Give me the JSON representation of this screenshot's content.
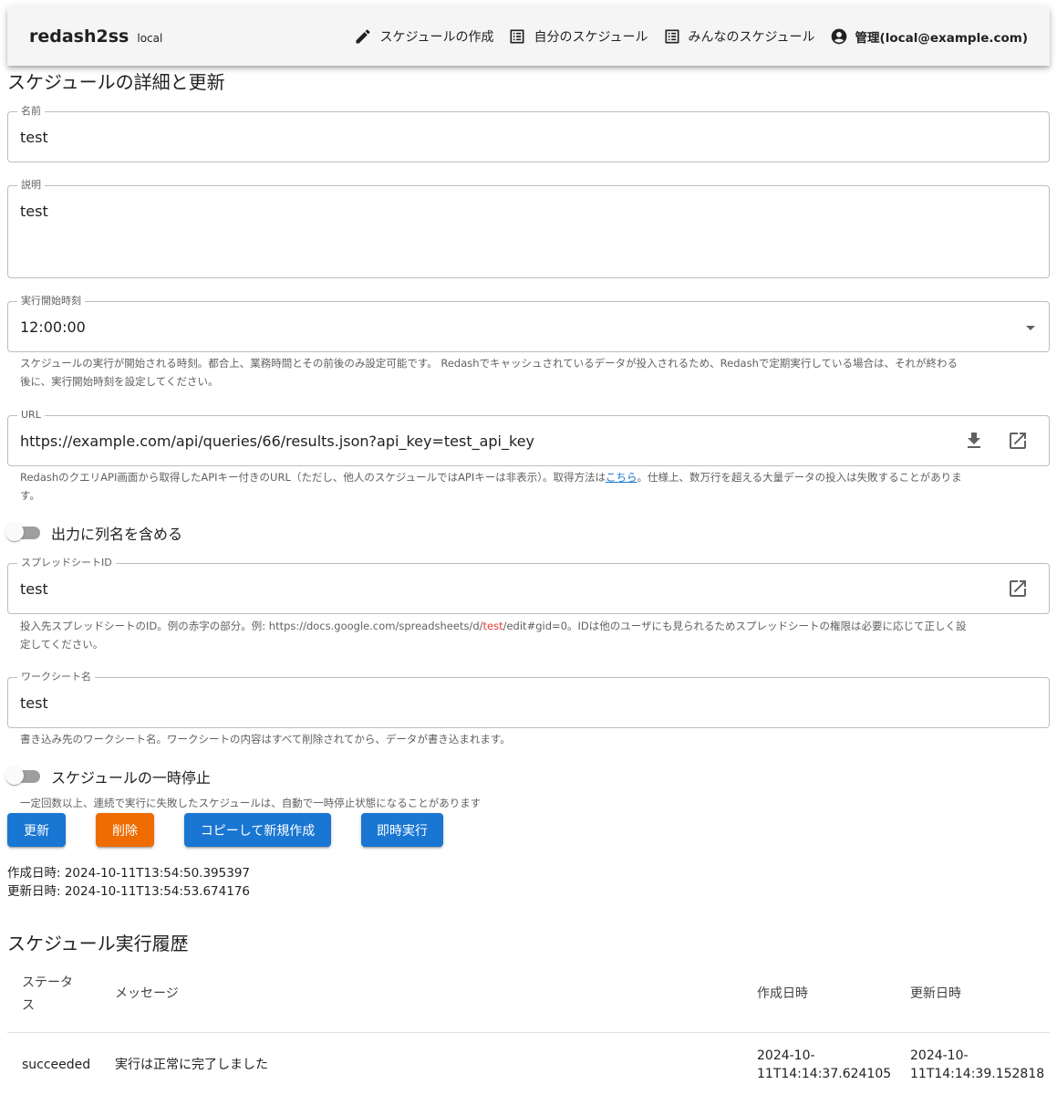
{
  "app": {
    "title": "redash2ss",
    "env": "local"
  },
  "nav": {
    "items": [
      {
        "icon": "pencil-icon",
        "label": "スケジュールの作成"
      },
      {
        "icon": "list-icon",
        "label": "自分のスケジュール"
      },
      {
        "icon": "list-icon",
        "label": "みんなのスケジュール"
      },
      {
        "icon": "account-circle-icon",
        "label": "管理(local@example.com)"
      }
    ]
  },
  "page": {
    "title": "スケジュールの詳細と更新"
  },
  "form": {
    "name": {
      "label": "名前",
      "value": "test"
    },
    "description": {
      "label": "説明",
      "value": "test"
    },
    "start_time": {
      "label": "実行開始時刻",
      "value": "12:00:00",
      "hint_line1": "スケジュールの実行が開始される時刻。都合上、業務時間とその前後のみ設定可能です。 Redashでキャッシュされているデータが投入されるため、Redashで定期実行している場合は、それが終わる",
      "hint_line2": "後に、実行開始時刻を設定してください。"
    },
    "url": {
      "label": "URL",
      "value": "https://example.com/api/queries/66/results.json?api_key=test_api_key",
      "hint_pre": "RedashのクエリAPI画面から取得したAPIキー付きのURL（ただし、他人のスケジュールではAPIキーは非表示）。取得方法は",
      "hint_link": "こちら",
      "hint_post": "。仕様上、数万行を超える大量データの投入は失敗することがありま",
      "hint_line2": "す。"
    },
    "include_header": {
      "label": "出力に列名を含める",
      "checked": false
    },
    "spreadsheet_id": {
      "label": "スプレッドシートID",
      "value": "test",
      "hint_pre": "投入先スプレッドシートのID。例の赤字の部分。例: https://docs.google.com/spreadsheets/d/",
      "hint_red": "test",
      "hint_post": "/edit#gid=0。IDは他のユーザにも見られるためスプレッドシートの権限は必要に応じて正しく設",
      "hint_line2": "定してください。"
    },
    "worksheet": {
      "label": "ワークシート名",
      "value": "test",
      "hint": "書き込み先のワークシート名。ワークシートの内容はすべて削除されてから、データが書き込まれます。"
    },
    "pause": {
      "label": "スケジュールの一時停止",
      "checked": false,
      "hint": "一定回数以上、連続で実行に失敗したスケジュールは、自動で一時停止状態になることがあります"
    }
  },
  "actions": {
    "update": "更新",
    "delete": "削除",
    "copy": "コピーして新規作成",
    "run_now": "即時実行"
  },
  "meta": {
    "created": "作成日時: 2024-10-11T13:54:50.395397",
    "updated": "更新日時: 2024-10-11T13:54:53.674176"
  },
  "history": {
    "title": "スケジュール実行履歴",
    "columns": {
      "status_l1": "ステータ",
      "status_l2": "ス",
      "message": "メッセージ",
      "created": "作成日時",
      "updated": "更新日時"
    },
    "rows": [
      {
        "status": "succeeded",
        "message": "実行は正常に完了しました",
        "created_l1": "2024-10-",
        "created_l2": "11T14:14:37.624105",
        "updated_l1": "2024-10-",
        "updated_l2": "11T14:14:39.152818"
      }
    ]
  },
  "colors": {
    "primary": "#1976d2",
    "warn": "#ef6c00",
    "accent_red": "#e53935"
  }
}
